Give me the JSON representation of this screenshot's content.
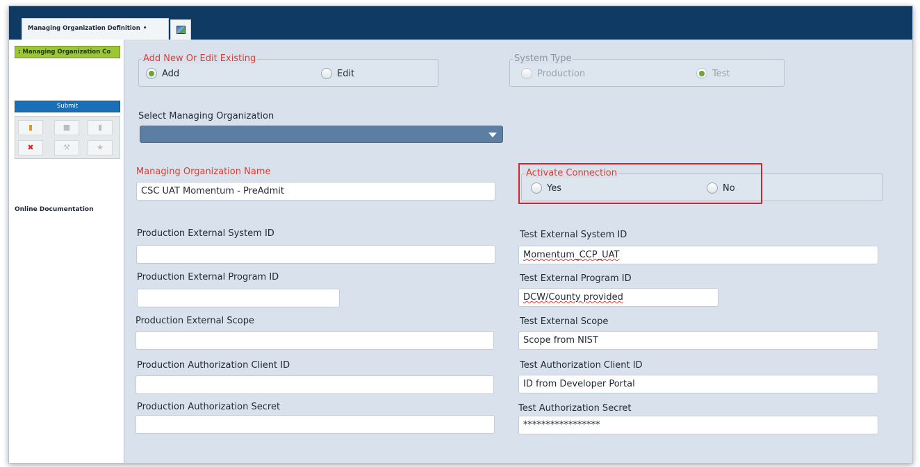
{
  "tabs": {
    "active_label": "Managing Organization Definition",
    "active_pin": "•",
    "second_icon": "image-icon"
  },
  "sidebar": {
    "item_label": ": Managing Organization Co",
    "submit_label": "Submit",
    "online_doc_label": "Online Documentation"
  },
  "form": {
    "add_edit": {
      "legend": "Add New Or Edit Existing",
      "options": [
        "Add",
        "Edit"
      ],
      "selected": "Add"
    },
    "system_type": {
      "legend": "System Type",
      "options": [
        "Production",
        "Test"
      ],
      "selected": "Test"
    },
    "select_org_label": "Select Managing Organization",
    "select_org_value": "",
    "org_name_label": "Managing Organization Name",
    "org_name_value": "CSC UAT Momentum - PreAdmit",
    "activate": {
      "legend": "Activate Connection",
      "options": [
        "Yes",
        "No"
      ],
      "selected": ""
    },
    "production": {
      "system_id_label": "Production External System ID",
      "system_id_value": "",
      "program_id_label": "Production External Program ID",
      "program_id_value": "",
      "scope_label": "Production External Scope",
      "scope_value": "",
      "client_id_label": "Production Authorization Client ID",
      "client_id_value": "",
      "secret_label": "Production Authorization Secret",
      "secret_value": ""
    },
    "test": {
      "system_id_label": "Test External System ID",
      "system_id_value": "Momentum_CCP_UAT",
      "program_id_label": "Test External Program ID",
      "program_id_value": "DCW/County provided",
      "scope_label": "Test External Scope",
      "scope_value": "Scope from NIST",
      "client_id_label": "Test Authorization Client ID",
      "client_id_value": "ID from Developer Portal",
      "secret_label": "Test Authorization Secret",
      "secret_value": "*****************"
    }
  },
  "colors": {
    "header": "#0f3a63",
    "panel": "#d9e2ec",
    "accent_green": "#9cc638",
    "required_red": "#e03b2f",
    "highlight_red": "#d8232a",
    "submit_blue": "#1a6fb6"
  }
}
